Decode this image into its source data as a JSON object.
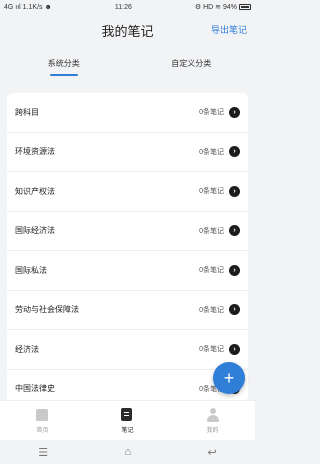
{
  "status_bar": {
    "left": "4G ııl 1.1K/s ☻",
    "time": "11:26",
    "right": "⚙ HD ≋ 94%"
  },
  "header": {
    "title": "我的笔记",
    "action": "导出笔记"
  },
  "tabs": [
    {
      "label": "系统分类",
      "active": true
    },
    {
      "label": "自定义分类",
      "active": false
    }
  ],
  "categories": [
    {
      "title": "跨科目",
      "count": "0条笔记"
    },
    {
      "title": "环境资源法",
      "count": "0条笔记"
    },
    {
      "title": "知识产权法",
      "count": "0条笔记"
    },
    {
      "title": "国际经济法",
      "count": "0条笔记"
    },
    {
      "title": "国际私法",
      "count": "0条笔记"
    },
    {
      "title": "劳动与社会保障法",
      "count": "0条笔记"
    },
    {
      "title": "经济法",
      "count": "0条笔记"
    },
    {
      "title": "中国法律史",
      "count": "0条笔记"
    }
  ],
  "fab": {
    "label": "+"
  },
  "bottom_nav": [
    {
      "label": "首页",
      "icon": "home-icon",
      "active": false
    },
    {
      "label": "笔记",
      "icon": "note-icon",
      "active": true
    },
    {
      "label": "我的",
      "icon": "profile-icon",
      "active": false
    }
  ],
  "system_nav": {
    "menu": "☰",
    "home": "⌂",
    "back": "↩"
  },
  "colors": {
    "accent": "#2f7ed8",
    "background": "#f2f3f5"
  }
}
